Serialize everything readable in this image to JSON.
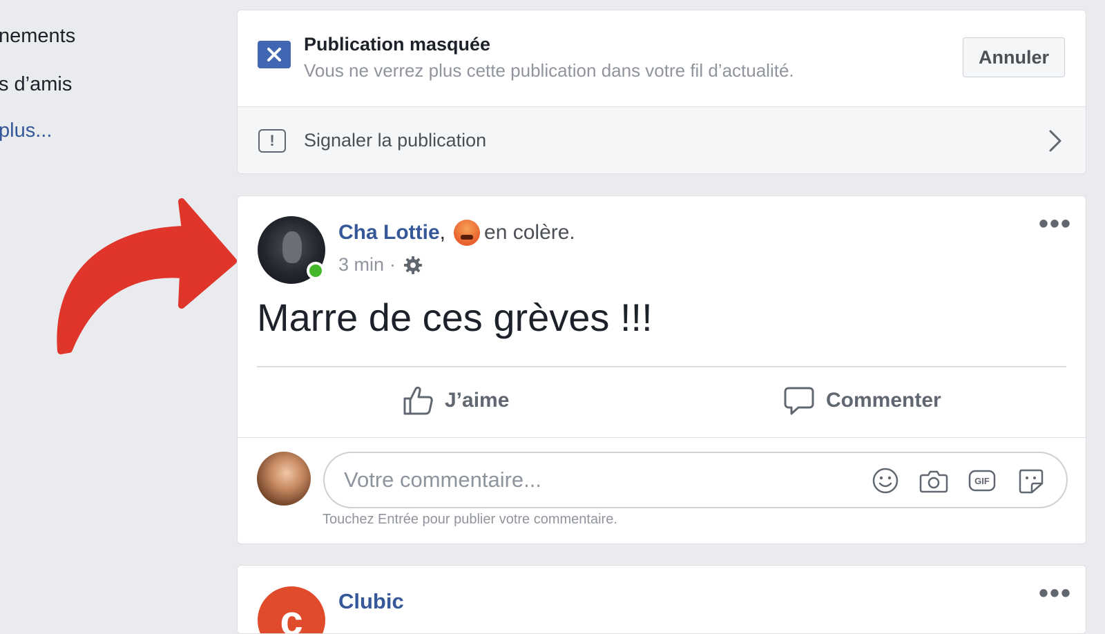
{
  "sidebar": {
    "items": [
      {
        "label": "nements"
      },
      {
        "label": "s d’amis"
      },
      {
        "label": "plus..."
      }
    ]
  },
  "hidden_post": {
    "title": "Publication masquée",
    "subtitle": "Vous ne verrez plus cette publication dans votre fil d’actualité.",
    "cancel_label": "Annuler",
    "report_label": "Signaler la publication",
    "report_icon_glyph": "!"
  },
  "post": {
    "author": "Cha Lottie",
    "separator": ",",
    "feeling": "en colère.",
    "time": "3 min",
    "meta_separator": "·",
    "text": "Marre de ces grèves !!!",
    "more_glyph": "•••",
    "like_label": "J’aime",
    "comment_label": "Commenter",
    "comment_placeholder": "Votre commentaire...",
    "comment_hint": "Touchez Entrée pour publier votre commentaire.",
    "gif_label": "GIF"
  },
  "next_post": {
    "author": "Clubic",
    "avatar_letter": "c",
    "more_glyph": "•••"
  },
  "icons": {
    "hide": "close-icon",
    "report": "alert-icon",
    "chevron": "chevron-right-icon",
    "privacy": "gear-icon",
    "like": "thumbs-up-icon",
    "comment": "speech-bubble-icon",
    "emoji": "smiley-icon",
    "camera": "camera-icon",
    "gif": "gif-icon",
    "sticker": "sticker-icon"
  },
  "colors": {
    "brand_blue": "#4267b2",
    "link_blue": "#365899",
    "online_green": "#42b72a",
    "arrow_red": "#e0352b",
    "background": "#e9ebee"
  }
}
